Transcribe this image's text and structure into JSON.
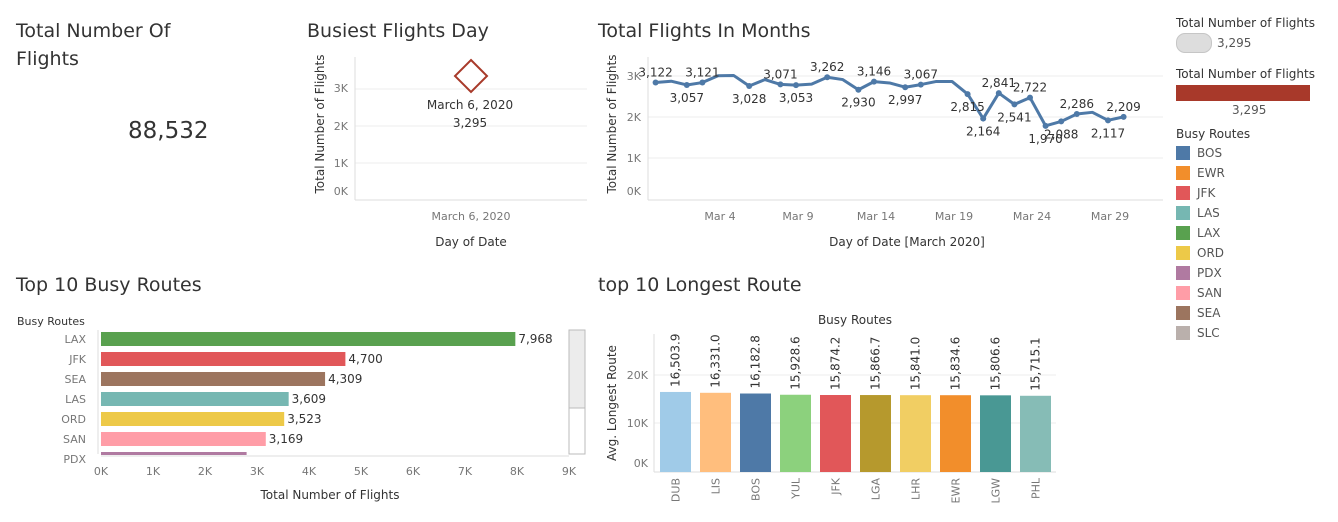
{
  "kpi": {
    "title_line1": "Total Number Of",
    "title_line2": "Flights",
    "value": "88,532"
  },
  "busiest": {
    "title": "Busiest Flights Day",
    "annotation_date": "March 6, 2020",
    "annotation_value": "3,295",
    "xlabel": "Day of Date",
    "ylabel": "Total Number of Flights",
    "x_tick": "March 6, 2020",
    "y_ticks": [
      "3K",
      "2K",
      "1K",
      "0K"
    ]
  },
  "months": {
    "title": "Total Flights In Months",
    "xlabel": "Day of Date [March 2020]",
    "ylabel": "Total Number of Flights",
    "x_ticks": [
      "Mar 4",
      "Mar 9",
      "Mar 14",
      "Mar 19",
      "Mar 24",
      "Mar 29"
    ],
    "y_ticks": [
      "3K",
      "2K",
      "1K",
      "0K"
    ]
  },
  "busy_routes": {
    "title": "Top 10 Busy Routes",
    "header": "Busy Routes",
    "xlabel": "Total Number of Flights",
    "x_ticks": [
      "0K",
      "1K",
      "2K",
      "3K",
      "4K",
      "5K",
      "6K",
      "7K",
      "8K",
      "9K"
    ]
  },
  "longest": {
    "title": "top 10 Longest Route",
    "header": "Busy Routes",
    "ylabel": "Avg. Longest Route",
    "y_ticks": [
      "20K",
      "10K",
      "0K"
    ]
  },
  "legend": {
    "size_title": "Total Number of Flights",
    "size_value": "3,295",
    "color_title": "Total Number of Flights",
    "color_value": "3,295",
    "routes_title": "Busy Routes",
    "routes": [
      {
        "name": "BOS",
        "color": "#4e79a7"
      },
      {
        "name": "EWR",
        "color": "#f28e2b"
      },
      {
        "name": "JFK",
        "color": "#e15759"
      },
      {
        "name": "LAS",
        "color": "#76b7b2"
      },
      {
        "name": "LAX",
        "color": "#59a14f"
      },
      {
        "name": "ORD",
        "color": "#edc948"
      },
      {
        "name": "PDX",
        "color": "#b07aa1"
      },
      {
        "name": "SAN",
        "color": "#ff9da7"
      },
      {
        "name": "SEA",
        "color": "#9c755f"
      },
      {
        "name": "SLC",
        "color": "#bab0ac"
      }
    ]
  },
  "chart_data": [
    {
      "type": "scatter",
      "title": "Busiest Flights Day",
      "xlabel": "Day of Date",
      "ylabel": "Total Number of Flights",
      "x": [
        "March 6, 2020"
      ],
      "y": [
        3295
      ],
      "ylim": [
        0,
        3800
      ],
      "marker_color": "#a83a2a"
    },
    {
      "type": "line",
      "title": "Total Flights In Months",
      "xlabel": "Day of Date [March 2020]",
      "ylabel": "Total Number of Flights",
      "x": [
        1,
        2,
        3,
        4,
        5,
        6,
        7,
        8,
        9,
        10,
        11,
        12,
        13,
        14,
        15,
        16,
        17,
        18,
        19,
        20,
        21,
        22,
        23,
        24,
        25,
        26,
        27,
        28,
        29,
        30,
        31
      ],
      "y": [
        3122,
        3157,
        3057,
        3121,
        3303,
        3310,
        3028,
        3200,
        3071,
        3053,
        3080,
        3262,
        3200,
        2930,
        3146,
        3110,
        2997,
        3067,
        3150,
        3150,
        2815,
        2164,
        2841,
        2541,
        2722,
        1970,
        2088,
        2286,
        2330,
        2117,
        2209
      ],
      "labels": {
        "1": "3,122",
        "3": "3,057",
        "4": "3,121",
        "7": "3,028",
        "9": "3,071",
        "10": "3,053",
        "12": "3,262",
        "14": "2,930",
        "15": "3,146",
        "17": "2,997",
        "18": "3,067",
        "21": "2,815",
        "22": "2,164",
        "23": "2,841",
        "24": "2,541",
        "25": "2,722",
        "26": "1,970",
        "27": "2,088",
        "28": "2,286",
        "30": "2,117",
        "31": "2,209"
      },
      "ylim": [
        0,
        3800
      ],
      "color": "#4e79a7"
    },
    {
      "type": "bar",
      "orientation": "horizontal",
      "title": "Top 10 Busy Routes",
      "xlabel": "Total Number of Flights",
      "categories": [
        "LAX",
        "JFK",
        "SEA",
        "LAS",
        "ORD",
        "SAN",
        "PDX"
      ],
      "values": [
        7968,
        4700,
        4309,
        3609,
        3523,
        3169,
        2800
      ],
      "value_labels": [
        "7,968",
        "4,700",
        "4,309",
        "3,609",
        "3,523",
        "3,169",
        ""
      ],
      "colors": [
        "#59a14f",
        "#e15759",
        "#9c755f",
        "#76b7b2",
        "#edc948",
        "#ff9da7",
        "#b07aa1"
      ],
      "xlim": [
        0,
        9000
      ]
    },
    {
      "type": "bar",
      "title": "top 10 Longest Route",
      "xlabel": "Busy Routes",
      "ylabel": "Avg. Longest Route",
      "categories": [
        "DUB",
        "LIS",
        "BOS",
        "YUL",
        "JFK",
        "LGA",
        "LHR",
        "EWR",
        "LGW",
        "PHL"
      ],
      "values": [
        16503.9,
        16331.0,
        16182.8,
        15928.6,
        15874.2,
        15866.7,
        15841.0,
        15834.6,
        15806.6,
        15715.1
      ],
      "value_labels": [
        "16,503.9",
        "16,331.0",
        "16,182.8",
        "15,928.6",
        "15,874.2",
        "15,866.7",
        "15,841.0",
        "15,834.6",
        "15,806.6",
        "15,715.1"
      ],
      "colors": [
        "#a0cbe8",
        "#ffbe7d",
        "#4e79a7",
        "#8cd17d",
        "#e15759",
        "#b6992d",
        "#f1ce63",
        "#f28e2b",
        "#499894",
        "#86bcb6"
      ],
      "ylim": [
        0,
        27000
      ]
    }
  ]
}
